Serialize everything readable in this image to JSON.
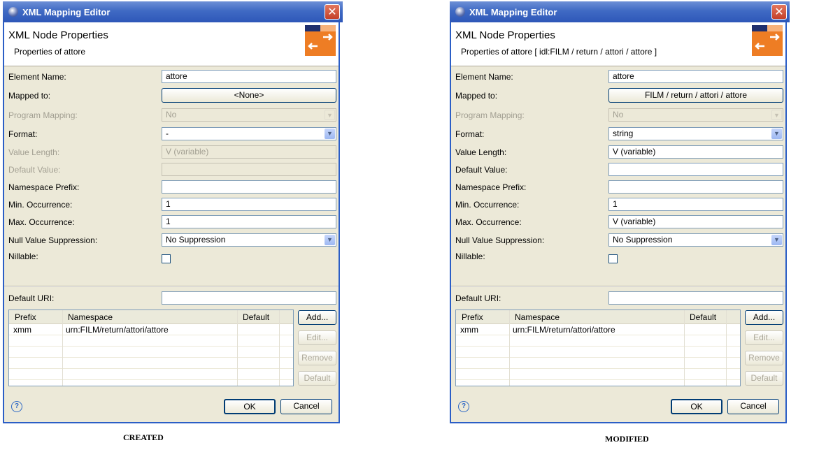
{
  "dialogs": [
    {
      "title": "XML Mapping Editor",
      "heading": "XML Node Properties",
      "subheading": "Properties of attore",
      "labels": {
        "element_name": "Element Name:",
        "mapped_to": "Mapped to:",
        "program_mapping": "Program Mapping:",
        "format": "Format:",
        "value_length": "Value Length:",
        "default_value": "Default Value:",
        "namespace_prefix": "Namespace Prefix:",
        "min_occurrence": "Min. Occurrence:",
        "max_occurrence": "Max. Occurrence:",
        "null_value_suppression": "Null Value Suppression:",
        "nillable": "Nillable:",
        "default_uri": "Default URI:"
      },
      "values": {
        "element_name": "attore",
        "mapped_to": "<None>",
        "program_mapping": "No",
        "format": "-",
        "value_length": "V (variable)",
        "default_value": "",
        "namespace_prefix": "",
        "min_occurrence": "1",
        "max_occurrence": "1",
        "null_value_suppression": "No Suppression",
        "nillable": false,
        "default_uri": ""
      },
      "table": {
        "columns": [
          "Prefix",
          "Namespace",
          "Default"
        ],
        "rows": [
          {
            "prefix": "xmm",
            "namespace": "urn:FILM/return/attori/attore",
            "default": ""
          }
        ]
      },
      "buttons": {
        "add": "Add...",
        "edit": "Edit...",
        "remove": "Remove",
        "default": "Default",
        "ok": "OK",
        "cancel": "Cancel"
      },
      "caption": "CREATED"
    },
    {
      "title": "XML Mapping Editor",
      "heading": "XML Node Properties",
      "subheading": "Properties of attore  [ idl:FILM / return / attori / attore ]",
      "labels": {
        "element_name": "Element Name:",
        "mapped_to": "Mapped to:",
        "program_mapping": "Program Mapping:",
        "format": "Format:",
        "value_length": "Value Length:",
        "default_value": "Default Value:",
        "namespace_prefix": "Namespace Prefix:",
        "min_occurrence": "Min. Occurrence:",
        "max_occurrence": "Max. Occurrence:",
        "null_value_suppression": "Null Value Suppression:",
        "nillable": "Nillable:",
        "default_uri": "Default URI:"
      },
      "values": {
        "element_name": "attore",
        "mapped_to": "FILM / return / attori / attore",
        "program_mapping": "No",
        "format": "string",
        "value_length": "V (variable)",
        "default_value": "",
        "namespace_prefix": "",
        "min_occurrence": "1",
        "max_occurrence": "V (variable)",
        "null_value_suppression": "No Suppression",
        "nillable": false,
        "default_uri": ""
      },
      "table": {
        "columns": [
          "Prefix",
          "Namespace",
          "Default"
        ],
        "rows": [
          {
            "prefix": "xmm",
            "namespace": "urn:FILM/return/attori/attore",
            "default": ""
          }
        ]
      },
      "buttons": {
        "add": "Add...",
        "edit": "Edit...",
        "remove": "Remove",
        "default": "Default",
        "ok": "OK",
        "cancel": "Cancel"
      },
      "caption": "MODIFIED"
    }
  ],
  "icons": {
    "app": "eclipse-icon",
    "close": "close-icon",
    "wizard": "xml-mapping-icon",
    "help": "help-icon",
    "dropdown": "chevron-down-icon"
  },
  "colors": {
    "titlebar": "#2e57b8",
    "dialog_bg": "#ece9d8",
    "accent": "#316ac5",
    "wizard_icon": "#ee7d24"
  }
}
